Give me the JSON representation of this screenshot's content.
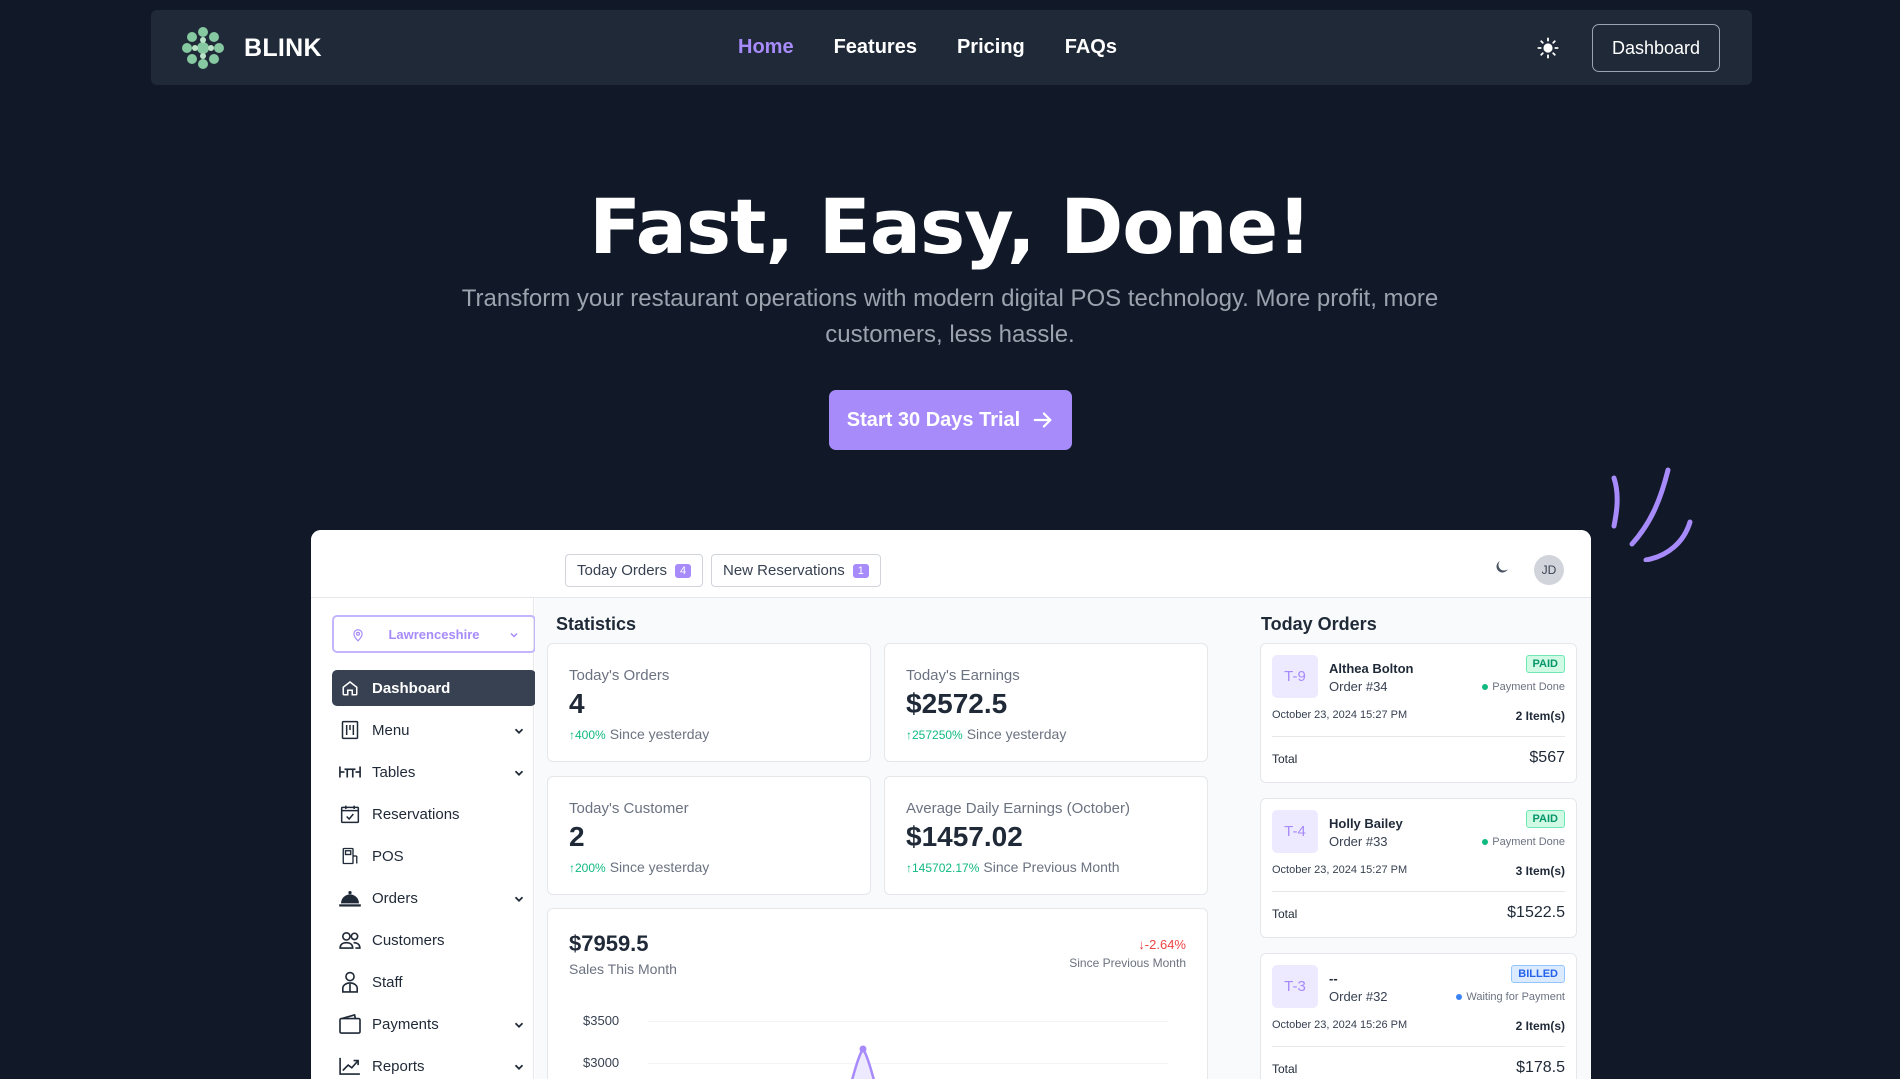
{
  "nav": {
    "brand": "BLINK",
    "links": [
      "Home",
      "Features",
      "Pricing",
      "FAQs"
    ],
    "active_link": "Home",
    "theme_icon": "sun-icon",
    "dashboard_label": "Dashboard"
  },
  "hero": {
    "title": "Fast, Easy, Done!",
    "subtitle": "Transform your restaurant operations with modern digital POS technology. More profit, more customers, less hassle.",
    "cta_label": "Start 30 Days Trial"
  },
  "colors": {
    "bg": "#111827",
    "nav_bg": "#1f2937",
    "accent": "#a78bfa",
    "muted": "#9ca3af"
  },
  "app": {
    "top_pills": [
      {
        "label": "Today Orders",
        "count": "4"
      },
      {
        "label": "New Reservations",
        "count": "1"
      }
    ],
    "avatar_initials": "JD",
    "location": "Lawrenceshire",
    "sidebar": [
      {
        "label": "Dashboard",
        "icon": "home-icon",
        "active": true,
        "expandable": false
      },
      {
        "label": "Menu",
        "icon": "menu-icon",
        "expandable": true
      },
      {
        "label": "Tables",
        "icon": "tables-icon",
        "expandable": true
      },
      {
        "label": "Reservations",
        "icon": "calendar-check-icon",
        "expandable": false
      },
      {
        "label": "POS",
        "icon": "pos-icon",
        "expandable": false
      },
      {
        "label": "Orders",
        "icon": "cloche-icon",
        "expandable": true
      },
      {
        "label": "Customers",
        "icon": "users-icon",
        "expandable": false
      },
      {
        "label": "Staff",
        "icon": "staff-icon",
        "expandable": false
      },
      {
        "label": "Payments",
        "icon": "wallet-icon",
        "expandable": true
      },
      {
        "label": "Reports",
        "icon": "chart-icon",
        "expandable": true
      }
    ],
    "statistics": {
      "title": "Statistics",
      "cards": [
        {
          "label": "Today's Orders",
          "value": "4",
          "change": "400%",
          "since": "Since yesterday"
        },
        {
          "label": "Today's Earnings",
          "value": "$2572.5",
          "change": "257250%",
          "since": "Since yesterday"
        },
        {
          "label": "Today's Customer",
          "value": "2",
          "change": "200%",
          "since": "Since yesterday"
        },
        {
          "label": "Average Daily Earnings (October)",
          "value": "$1457.02",
          "change": "145702.17%",
          "since": "Since Previous Month"
        }
      ],
      "sales": {
        "value": "$7959.5",
        "label": "Sales This Month",
        "change": "-2.64%",
        "since": "Since Previous Month",
        "y_ticks": [
          "$3500",
          "$3000"
        ]
      }
    },
    "today_orders": {
      "title": "Today Orders",
      "orders": [
        {
          "table": "T-9",
          "customer": "Althea Bolton",
          "order": "Order #34",
          "status": "PAID",
          "payment": "Payment Done",
          "date": "October 23, 2024 15:27 PM",
          "items": "2 Item(s)",
          "total_label": "Total",
          "total": "$567"
        },
        {
          "table": "T-4",
          "customer": "Holly Bailey",
          "order": "Order #33",
          "status": "PAID",
          "payment": "Payment Done",
          "date": "October 23, 2024 15:27 PM",
          "items": "3 Item(s)",
          "total_label": "Total",
          "total": "$1522.5"
        },
        {
          "table": "T-3",
          "customer": "--",
          "order": "Order #32",
          "status": "BILLED",
          "payment": "Waiting for Payment",
          "date": "October 23, 2024 15:26 PM",
          "items": "2 Item(s)",
          "total_label": "Total",
          "total": "$178.5"
        }
      ]
    }
  }
}
